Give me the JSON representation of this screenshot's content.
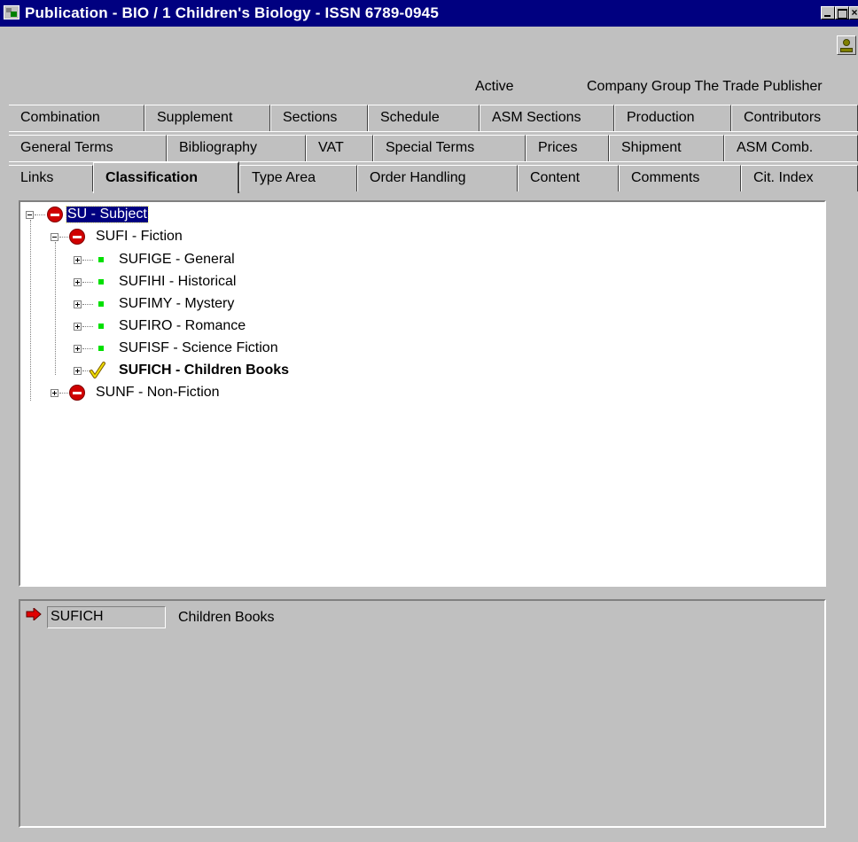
{
  "window": {
    "title": "Publication - BIO / 1 Children's Biology - ISSN 6789-0945",
    "icon": "app-icon"
  },
  "status": {
    "active_label": "Active",
    "company_text": "Company Group  The Trade Publisher"
  },
  "tabs": {
    "row1": [
      "Combination",
      "Supplement",
      "Sections",
      "Schedule",
      "ASM Sections",
      "Production",
      "Contributors"
    ],
    "row2": [
      "General Terms",
      "Bibliography",
      "VAT",
      "Special Terms",
      "Prices",
      "Shipment",
      "ASM Comb."
    ],
    "row3": [
      "Links",
      "Classification",
      "Type Area",
      "Order Handling",
      "Content",
      "Comments",
      "Cit. Index"
    ],
    "active": "Classification"
  },
  "tree": {
    "root": {
      "label": "SU - Subject",
      "icon": "no-entry-icon",
      "expanded": true,
      "selected": true
    },
    "fiction": {
      "label": "SUFI - Fiction",
      "icon": "no-entry-icon",
      "expanded": true
    },
    "children": [
      {
        "label": "SUFIGE - General",
        "icon": "green-dot-icon"
      },
      {
        "label": "SUFIHI - Historical",
        "icon": "green-dot-icon"
      },
      {
        "label": "SUFIMY - Mystery",
        "icon": "green-dot-icon"
      },
      {
        "label": "SUFIRO - Romance",
        "icon": "green-dot-icon"
      },
      {
        "label": "SUFISF - Science Fiction",
        "icon": "green-dot-icon"
      },
      {
        "label": "SUFICH - Children Books",
        "icon": "check-icon",
        "bold": true
      }
    ],
    "nonfiction": {
      "label": "SUNF - Non-Fiction",
      "icon": "no-entry-icon",
      "expanded": false
    }
  },
  "detail": {
    "code": "SUFICH",
    "description": "Children Books",
    "icon": "arrow-right-icon"
  },
  "colors": {
    "titlebar": "#000080",
    "selection": "#000080",
    "no_entry": "#d00000",
    "green_dot": "#00e000",
    "check": "#e8d000",
    "arrow": "#e00000"
  }
}
